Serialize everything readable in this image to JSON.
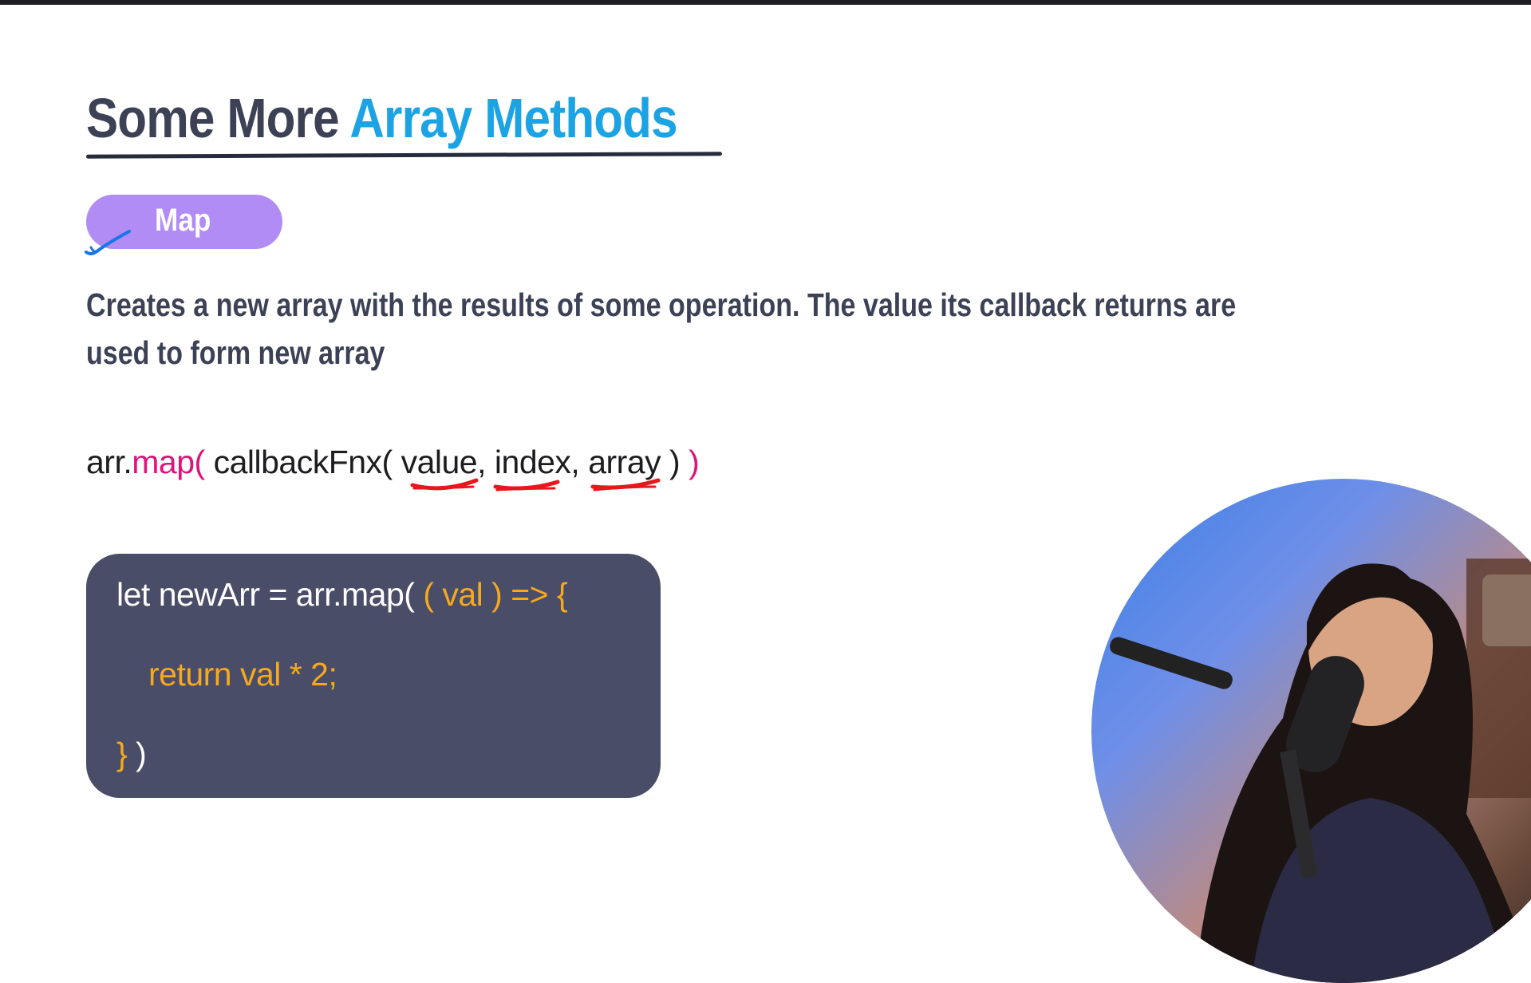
{
  "slide": {
    "title_plain": "Some More ",
    "title_accent": "Array Methods",
    "badge_label": "Map",
    "description": "Creates a new array with the results of some operation. The value its callback returns are used to form new array",
    "signature": {
      "object": "arr.",
      "method": "map(",
      "callback": " callbackFnx( ",
      "params": [
        "value",
        "index",
        "array"
      ],
      "sep1": ", ",
      "sep2": ", ",
      "inner_close": " )",
      "outer_close": " )"
    },
    "code": {
      "line1_white": "let newArr = arr.map(",
      "line1_orange": " ( val ) => {",
      "line2_orange": "return val * 2;",
      "line3_orange": "}",
      "line3_white": " )"
    }
  },
  "colors": {
    "title_plain": "#3c4156",
    "title_accent": "#1ba3e3",
    "badge": "#b18cf4",
    "method": "#e0127b",
    "code_bg": "#4a4d68",
    "code_orange": "#f4a91e",
    "annotation_red": "#e8171d",
    "check_blue": "#1976e8"
  }
}
